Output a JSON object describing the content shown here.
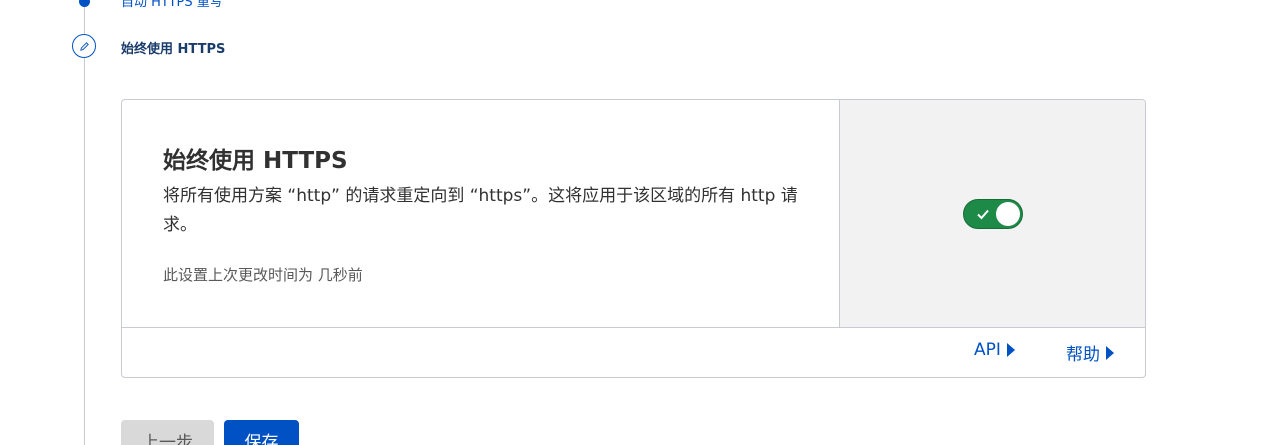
{
  "steps": {
    "previous_label": "自动 HTTPS 重写",
    "current_label": "始终使用 HTTPS"
  },
  "card": {
    "title": "始终使用 HTTPS",
    "description": "将所有使用方案 “http” 的请求重定向到 “https”。这将应用于该区域的所有 http 请求。",
    "meta": "此设置上次更改时间为 几秒前",
    "toggle_state": "on",
    "toggle_color": "#1e8a47"
  },
  "footer": {
    "api_label": "API",
    "help_label": "帮助"
  },
  "buttons": {
    "back_label": "上一步",
    "save_label": "保存"
  },
  "colors": {
    "accent": "#0051c3",
    "border": "#c8ccd1",
    "side_panel": "#f2f2f2"
  }
}
